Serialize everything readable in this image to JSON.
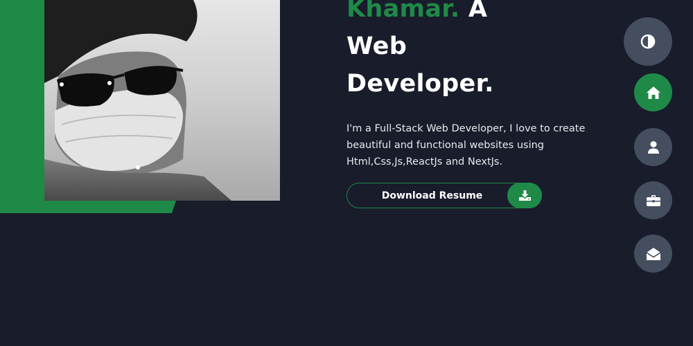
{
  "hero": {
    "name": "Khamar.",
    "title_rest_line1": " A",
    "title_line2": "Web",
    "title_line3": "Developer.",
    "description": "I'm a Full-Stack Web Developer, I love to create beautiful and functional websites using Html,Css,Js,ReactJs and NextJs.",
    "resume_button_label": "Download Resume",
    "resume_icon": "download-icon"
  },
  "nav": {
    "theme_icon": "theme-toggle-icon",
    "items": [
      {
        "icon": "home-icon",
        "active": true
      },
      {
        "icon": "user-icon",
        "active": false
      },
      {
        "icon": "briefcase-icon",
        "active": false
      },
      {
        "icon": "envelope-open-icon",
        "active": false
      }
    ]
  },
  "colors": {
    "background": "#181c2b",
    "accent": "#1f8a48",
    "nav_button": "#454e5f",
    "text": "#ffffff"
  }
}
